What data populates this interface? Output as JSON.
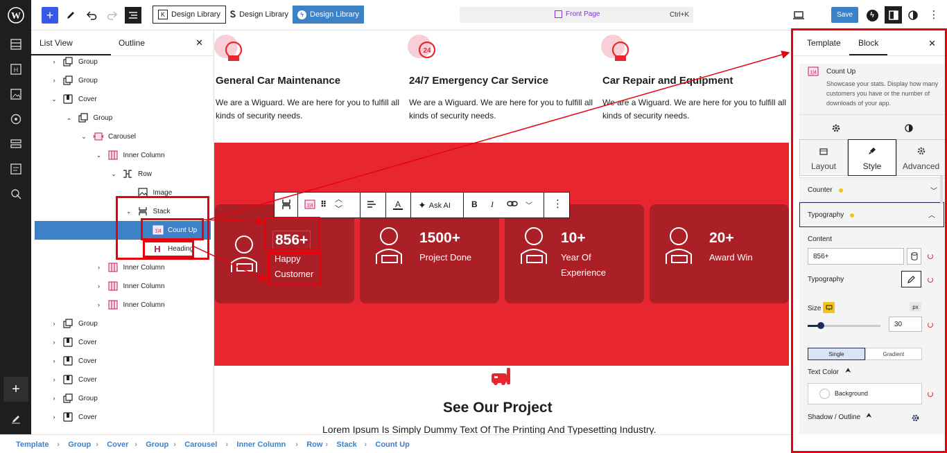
{
  "topbar": {
    "lib1": "Design Library",
    "lib2": "Design Library",
    "lib3": "Design Library",
    "page": "Front Page",
    "shortcut": "Ctrl+K",
    "save": "Save"
  },
  "listview": {
    "tab_list": "List View",
    "tab_outline": "Outline",
    "rows": [
      {
        "label": "Group",
        "depth": 0,
        "chev": "›",
        "icon": "group"
      },
      {
        "label": "Group",
        "depth": 0,
        "chev": "›",
        "icon": "group"
      },
      {
        "label": "Cover",
        "depth": 0,
        "chev": "⌄",
        "icon": "cover"
      },
      {
        "label": "Group",
        "depth": 1,
        "chev": "⌄",
        "icon": "group"
      },
      {
        "label": "Carousel",
        "depth": 2,
        "chev": "⌄",
        "icon": "carousel"
      },
      {
        "label": "Inner Column",
        "depth": 3,
        "chev": "⌄",
        "icon": "column"
      },
      {
        "label": "Row",
        "depth": 4,
        "chev": "⌄",
        "icon": "row"
      },
      {
        "label": "Image",
        "depth": 5,
        "chev": "",
        "icon": "image"
      },
      {
        "label": "Stack",
        "depth": 5,
        "chev": "⌄",
        "icon": "stack"
      },
      {
        "label": "Count Up",
        "depth": 6,
        "chev": "",
        "icon": "countup",
        "selected": true
      },
      {
        "label": "Heading",
        "depth": 6,
        "chev": "",
        "icon": "heading"
      },
      {
        "label": "Inner Column",
        "depth": 3,
        "chev": "›",
        "icon": "column"
      },
      {
        "label": "Inner Column",
        "depth": 3,
        "chev": "›",
        "icon": "column"
      },
      {
        "label": "Inner Column",
        "depth": 3,
        "chev": "›",
        "icon": "column"
      },
      {
        "label": "Group",
        "depth": 0,
        "chev": "›",
        "icon": "group"
      },
      {
        "label": "Cover",
        "depth": 0,
        "chev": "›",
        "icon": "cover"
      },
      {
        "label": "Cover",
        "depth": 0,
        "chev": "›",
        "icon": "cover"
      },
      {
        "label": "Cover",
        "depth": 0,
        "chev": "›",
        "icon": "cover"
      },
      {
        "label": "Group",
        "depth": 0,
        "chev": "›",
        "icon": "group"
      },
      {
        "label": "Cover",
        "depth": 0,
        "chev": "›",
        "icon": "cover"
      }
    ]
  },
  "services": [
    {
      "title": "General Car Maintenance",
      "text": "We are a Wiguard. We are here for you to fulfill all kinds of security needs."
    },
    {
      "title": "24/7 Emergency Car Service",
      "text": "We are a Wiguard. We are here for you to fulfill all kinds of security needs."
    },
    {
      "title": "Car Repair and Equipment",
      "text": "We are a Wiguard. We are here for you to fulfill all kinds of security needs."
    }
  ],
  "stats": [
    {
      "num": "856+",
      "l1": "Happy",
      "l2": "Customer"
    },
    {
      "num": "1500+",
      "l1": "Project Done",
      "l2": ""
    },
    {
      "num": "10+",
      "l1": "Year Of",
      "l2": "Experience"
    },
    {
      "num": "20+",
      "l1": "Award Win",
      "l2": ""
    }
  ],
  "toolbar": {
    "ask_ai": "Ask AI"
  },
  "project": {
    "title": "See Our Project",
    "subtitle": "Lorem Ipsum Is Simply Dummy Text Of The Printing And Typesetting Industry."
  },
  "inspector": {
    "tab_template": "Template",
    "tab_block": "Block",
    "block_name": "Count Up",
    "block_desc": "Showcase your stats. Display how many customers you have or the number of downloads of your app.",
    "seg_layout": "Layout",
    "seg_style": "Style",
    "seg_advanced": "Advanced",
    "counter": "Counter",
    "typography_panel": "Typography",
    "content_label": "Content",
    "content_value": "856+",
    "typography_label": "Typography",
    "size_label": "Size",
    "size_unit": "px",
    "size_value": "30",
    "size_level": 0.18,
    "single": "Single",
    "gradient": "Gradient",
    "text_color": "Text Color",
    "background": "Background",
    "shadow": "Shadow / Outline"
  },
  "breadcrumbs": [
    "Template",
    "Group",
    "Cover",
    "Group",
    "Carousel",
    "Inner Column",
    "Row",
    "Stack",
    "Count Up"
  ],
  "colors": {
    "accent": "#3d81c7",
    "brand_red": "#e8262f",
    "card_red": "#ab1f27",
    "wp_blue": "#3858e9"
  }
}
